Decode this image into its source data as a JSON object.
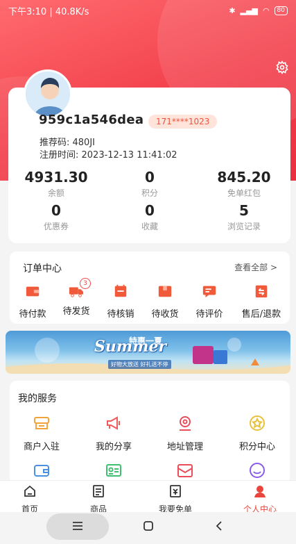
{
  "status": {
    "time_speed": "下午3:10 | 40.8K/s",
    "battery": "80"
  },
  "profile": {
    "username": "959c1a546dea",
    "phone": "171****1023",
    "referral": "推荐码: 480JI",
    "registered": "注册时间: 2023-12-13 11:41:02"
  },
  "stats": [
    {
      "value": "4931.30",
      "label": "余额"
    },
    {
      "value": "0",
      "label": "积分"
    },
    {
      "value": "845.20",
      "label": "免单红包"
    },
    {
      "value": "0",
      "label": "优惠券"
    },
    {
      "value": "0",
      "label": "收藏"
    },
    {
      "value": "5",
      "label": "浏览记录"
    }
  ],
  "orders": {
    "title": "订单中心",
    "view_all": "查看全部 >",
    "items": [
      {
        "label": "待付款",
        "icon": "wallet-icon"
      },
      {
        "label": "待发货",
        "icon": "truck-icon",
        "badge": "3"
      },
      {
        "label": "待核销",
        "icon": "calendar-icon"
      },
      {
        "label": "待收货",
        "icon": "box-icon"
      },
      {
        "label": "待评价",
        "icon": "comment-icon"
      },
      {
        "label": "售后/退款",
        "icon": "refund-icon"
      }
    ]
  },
  "banner": {
    "cn": "特惠一夏",
    "title": "Summer",
    "sub": "好物大放送  好礼送不停"
  },
  "services": {
    "title": "我的服务",
    "items": [
      {
        "label": "商户入驻",
        "icon": "merchant-icon",
        "color": "#f2a33a"
      },
      {
        "label": "我的分享",
        "icon": "megaphone-icon",
        "color": "#f05a5a"
      },
      {
        "label": "地址管理",
        "icon": "location-icon",
        "color": "#e84d5a"
      },
      {
        "label": "积分中心",
        "icon": "star-icon",
        "color": "#e8c13a"
      },
      {
        "label": "",
        "icon": "wallet-outline-icon",
        "color": "#4a90e2"
      },
      {
        "label": "",
        "icon": "id-card-icon",
        "color": "#3fbf6f"
      },
      {
        "label": "",
        "icon": "gift-icon",
        "color": "#e84d5a"
      },
      {
        "label": "",
        "icon": "support-icon",
        "color": "#8a5ae8"
      }
    ]
  },
  "tabs": [
    {
      "label": "首页",
      "icon": "home-icon"
    },
    {
      "label": "商品",
      "icon": "list-icon"
    },
    {
      "label": "我要免单",
      "icon": "coupon-icon"
    },
    {
      "label": "个人中心",
      "icon": "user-icon"
    }
  ],
  "colors": {
    "accent": "#e8453c",
    "hero": "#f2404c"
  }
}
